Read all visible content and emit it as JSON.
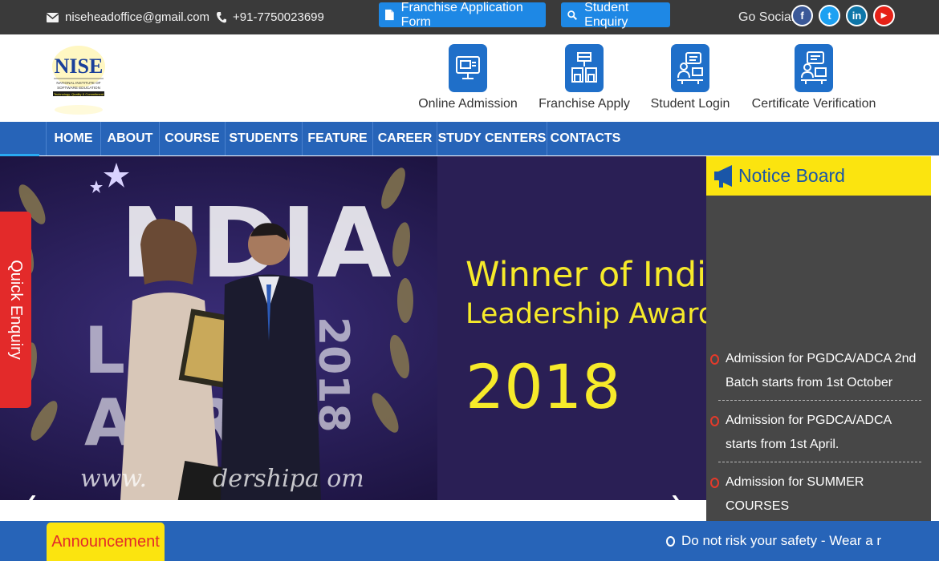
{
  "topbar": {
    "email": "niseheadoffice@gmail.com",
    "phone": "+91-7750023699",
    "franchise_form_label": "Franchise Application Form",
    "student_enquiry_label": "Student Enquiry",
    "go_social_label": "Go Social",
    "social": [
      {
        "name": "facebook",
        "glyph": "f",
        "color": "#3b5998"
      },
      {
        "name": "twitter",
        "glyph": "t",
        "color": "#1da1f2"
      },
      {
        "name": "linkedin",
        "glyph": "in",
        "color": "#0e76a8"
      },
      {
        "name": "youtube",
        "glyph": "▶",
        "color": "#e62117"
      }
    ]
  },
  "header": {
    "logo_text": "NISE",
    "logo_subtext": "NATIONAL INSTITUTE OF SOFTWARE EDUCATION",
    "logo_tagline": "Technology, Quality & Commitment",
    "quick_links": [
      {
        "label": "Online Admission",
        "icon": "computer-form-icon"
      },
      {
        "label": "Franchise Apply",
        "icon": "storefront-icon"
      },
      {
        "label": "Student Login",
        "icon": "student-desk-icon"
      },
      {
        "label": "Certificate Verification",
        "icon": "certificate-desk-icon"
      }
    ]
  },
  "nav": {
    "items": [
      "HOME",
      "ABOUT",
      "COURSE",
      "STUDENTS",
      "FEATURE",
      "CAREER",
      "STUDY CENTERS",
      "CONTACTS"
    ]
  },
  "slider": {
    "line1": "Winner of India",
    "line2": "Leadership Award",
    "line3": "2018",
    "prev_glyph": "‹",
    "next_glyph": "›"
  },
  "quick_enquiry": {
    "label": "Quick Enquiry"
  },
  "notice_board": {
    "title": "Notice Board",
    "items": [
      "Admission for PGDCA/ADCA 2nd Batch starts from 1st October",
      "Admission for PGDCA/ADCA starts from 1st April.",
      "Admission for SUMMER COURSES"
    ]
  },
  "announcement": {
    "label": "Announcement",
    "text": "Do not risk your safety - Wear a r"
  },
  "colors": {
    "topbar_bg": "#3a3a3a",
    "primary_blue": "#2764b8",
    "button_blue": "#1e88e5",
    "accent_yellow": "#fbe40f",
    "accent_red": "#e32a2a"
  }
}
